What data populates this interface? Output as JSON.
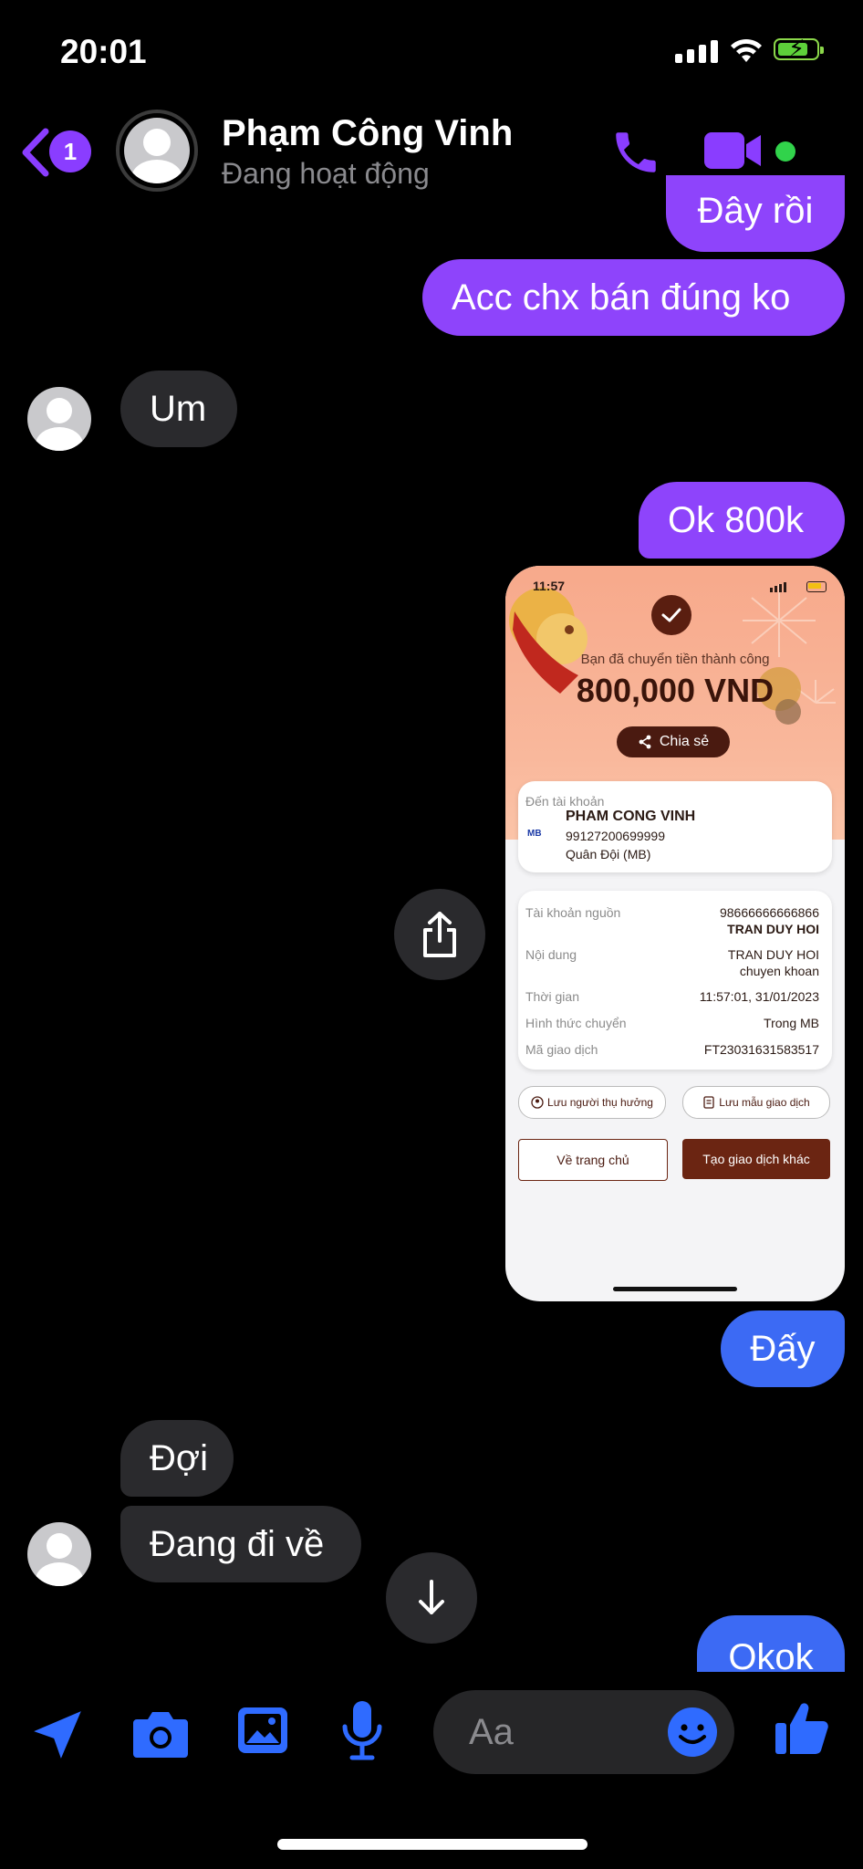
{
  "status_bar": {
    "time": "20:01"
  },
  "header": {
    "unread_count": "1",
    "contact_name": "Phạm Công Vinh",
    "presence": "Đang hoạt động"
  },
  "messages": [
    {
      "side": "out",
      "text": "Đây rồi"
    },
    {
      "side": "out",
      "text": "Acc chx bán đúng ko"
    },
    {
      "side": "in",
      "text": "Um"
    },
    {
      "side": "out",
      "text": "Ok 800k"
    },
    {
      "side": "out",
      "type": "image"
    },
    {
      "side": "out",
      "text": "Đấy"
    },
    {
      "side": "in",
      "text": "Đợi"
    },
    {
      "side": "in",
      "text": "Đang đi về"
    },
    {
      "side": "out",
      "text": "Okok"
    }
  ],
  "receipt": {
    "time": "11:57",
    "success_text": "Bạn đã chuyển tiền thành công",
    "amount": "800,000 VND",
    "share_label": "Chia sẻ",
    "to_account_label": "Đến tài khoản",
    "recipient_name": "PHAM CONG VINH",
    "recipient_account": "99127200699999",
    "recipient_bank": "Quân Đội (MB)",
    "bank_logo": "MB",
    "details": [
      {
        "label": "Tài khoản nguồn",
        "value": "98666666666866",
        "value2": "TRAN DUY HOI"
      },
      {
        "label": "Nội dung",
        "value": "TRAN DUY HOI",
        "value2": "chuyen khoan"
      },
      {
        "label": "Thời gian",
        "value": "11:57:01, 31/01/2023"
      },
      {
        "label": "Hình thức chuyển",
        "value": "Trong MB"
      },
      {
        "label": "Mã giao dịch",
        "value": "FT23031631583517"
      }
    ],
    "save_beneficiary": "Lưu người thụ hưởng",
    "save_template": "Lưu mẫu giao dịch",
    "home_button": "Về trang chủ",
    "new_transaction_button": "Tạo giao dịch khác"
  },
  "composer": {
    "placeholder": "Aa"
  },
  "colors": {
    "outgoing_bubble": "#8e44fb",
    "outgoing_bubble_bottom": "#3c6af4",
    "incoming_bubble": "#2a2a2d",
    "accent": "#8a3dff",
    "toolbar_icon": "#2f6bff",
    "receipt_primary": "#6b2512"
  }
}
